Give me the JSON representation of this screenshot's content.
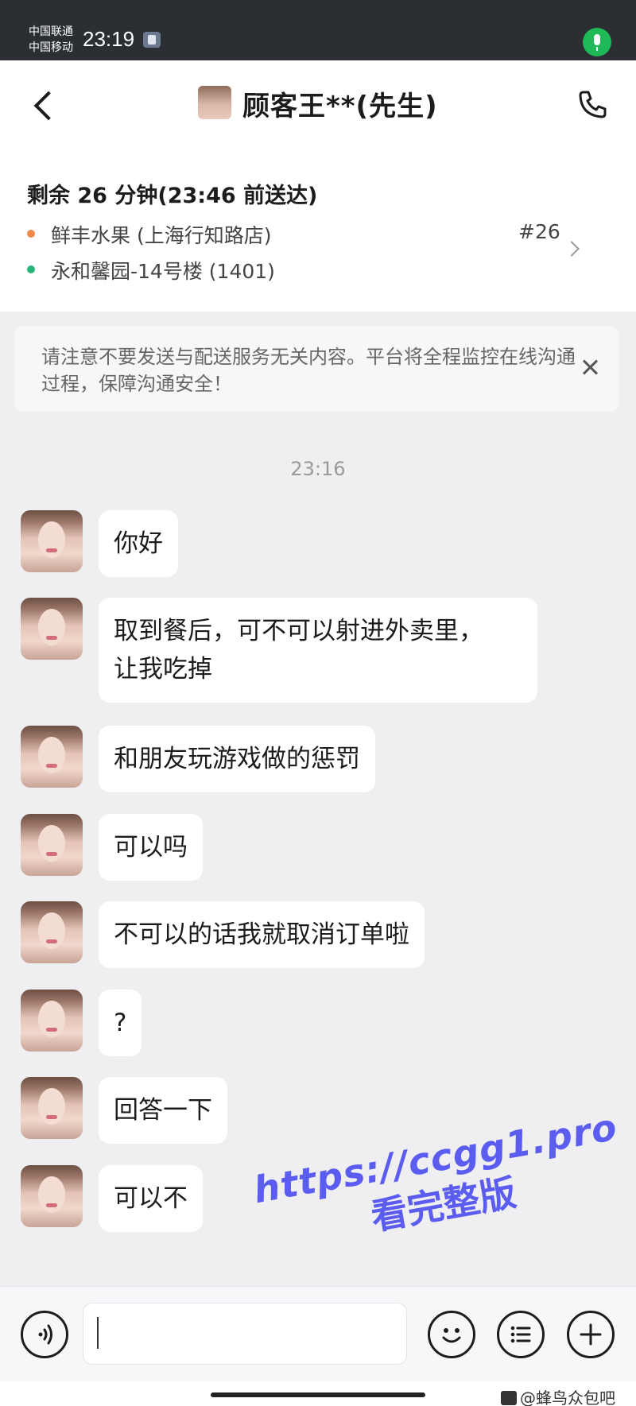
{
  "status_bar": {
    "carrier_1": "中国联通",
    "carrier_2": "中国移动",
    "time": "23:19",
    "mic_color": "#1fb957"
  },
  "header": {
    "title": "顾客王**(先生)",
    "back_icon": "chevron-left-icon",
    "call_icon": "phone-icon"
  },
  "order": {
    "remaining": "剩余 26 分钟(23:46 前送达)",
    "store": "鲜丰水果 (上海行知路店)",
    "destination": "永和馨园-14号楼 (1401)",
    "order_no": "#26"
  },
  "notice": {
    "text": "请注意不要发送与配送服务无关内容。平台将全程监控在线沟通过程，保障沟通安全！"
  },
  "chat": {
    "timestamp": "23:16",
    "messages": [
      {
        "text": "你好"
      },
      {
        "text": "取到餐后，可不可以射进外卖里，\n让我吃掉"
      },
      {
        "text": "和朋友玩游戏做的惩罚"
      },
      {
        "text": "可以吗"
      },
      {
        "text": "不可以的话我就取消订单啦"
      },
      {
        "text": "?"
      },
      {
        "text": "回答一下"
      },
      {
        "text": "可以不"
      }
    ]
  },
  "watermark": {
    "url": "https://ccgg1.pro",
    "subtitle": "看完整版",
    "color": "#5b5cf0"
  },
  "input_bar": {
    "value": "",
    "placeholder": ""
  },
  "footer": {
    "source": "@蜂鸟众包吧"
  }
}
